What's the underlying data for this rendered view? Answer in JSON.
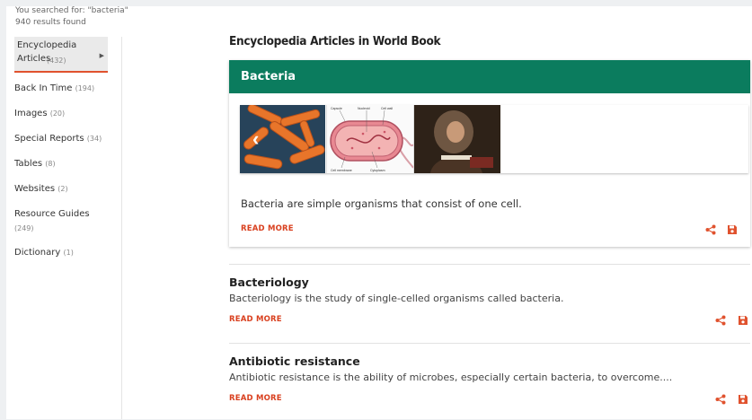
{
  "search": {
    "query_text": "You searched for: \"bacteria\"",
    "results_text": "940 results found"
  },
  "sidebar": {
    "items": [
      {
        "label": "Encyclopedia Articles",
        "count": "(432)",
        "active": true
      },
      {
        "label": "Back In Time",
        "count": "(194)"
      },
      {
        "label": "Images",
        "count": "(20)"
      },
      {
        "label": "Special Reports",
        "count": "(34)"
      },
      {
        "label": "Tables",
        "count": "(8)"
      },
      {
        "label": "Websites",
        "count": "(2)"
      },
      {
        "label": "Resource Guides",
        "count": "(249)"
      },
      {
        "label": "Dictionary",
        "count": "(1)"
      }
    ]
  },
  "main": {
    "section_title": "Encyclopedia Articles in World Book",
    "featured": {
      "title": "Bacteria",
      "description": "Bacteria are simple organisms that consist of one cell.",
      "read_more": "READ MORE",
      "carousel_icon": "chevron-left-icon",
      "images": [
        "bacteria-micrograph",
        "bacteria-cell-diagram",
        "portrait-painting"
      ],
      "diagram_labels": [
        "Capsule",
        "Nucleoid",
        "Cell wall",
        "Cell membrane",
        "Cytoplasm"
      ]
    },
    "articles": [
      {
        "title": "Bacteriology",
        "description": "Bacteriology is the study of single-celled organisms called bacteria.",
        "read_more": "READ MORE"
      },
      {
        "title": "Antibiotic resistance",
        "description": "Antibiotic resistance is the ability of microbes, especially certain bacteria, to overcome....",
        "read_more": "READ MORE"
      }
    ]
  },
  "icons": {
    "share": "share-icon",
    "save": "save-icon"
  },
  "colors": {
    "header_green": "#0b7c5e",
    "accent_red": "#d9401f",
    "active_underline": "#e0522e"
  }
}
